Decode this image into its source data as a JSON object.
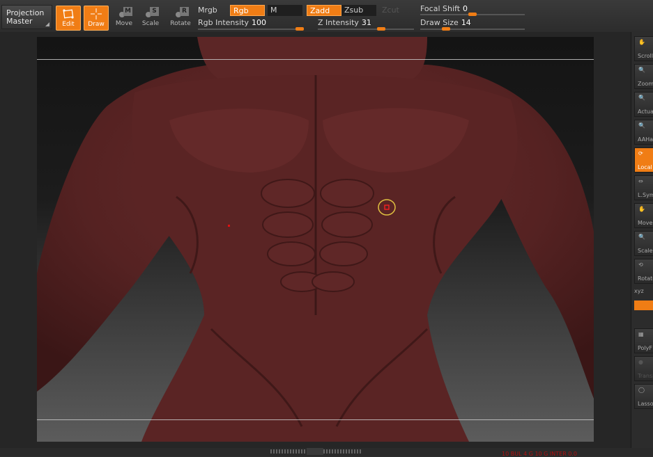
{
  "toolbar": {
    "projection_master": [
      "Projection",
      "Master"
    ],
    "edit_label": "Edit",
    "draw_label": "Draw",
    "move_label": "Move",
    "move_key": "M",
    "scale_label": "Scale",
    "scale_key": "S",
    "rotate_label": "Rotate",
    "rotate_key": "R",
    "mrgb_label": "Mrgb",
    "rgb_label": "Rgb",
    "m_label": "M",
    "rgb_intensity_label": "Rgb Intensity",
    "rgb_intensity_value": "100",
    "zadd_label": "Zadd",
    "zsub_label": "Zsub",
    "zcut_label": "Zcut",
    "z_intensity_label": "Z Intensity",
    "z_intensity_value": "31",
    "focal_shift_label": "Focal Shift",
    "focal_shift_value": "0",
    "draw_size_label": "Draw Size",
    "draw_size_value": "14"
  },
  "right_shelf": {
    "items": [
      "Scroll",
      "Zoom",
      "Actual",
      "AAHalf",
      "Local",
      "L.Sym",
      "Move",
      "Scale",
      "Rotate",
      "xyz",
      "",
      "",
      "PolyF",
      "Transp",
      "Lasso"
    ]
  },
  "colors": {
    "accent": "#f07d15",
    "skin": "#5a2424",
    "brush_ring": "#e0c040",
    "brush_dot": "#e01010"
  },
  "status_text": "10 BUL 4 G 10 G INTER 0.0"
}
